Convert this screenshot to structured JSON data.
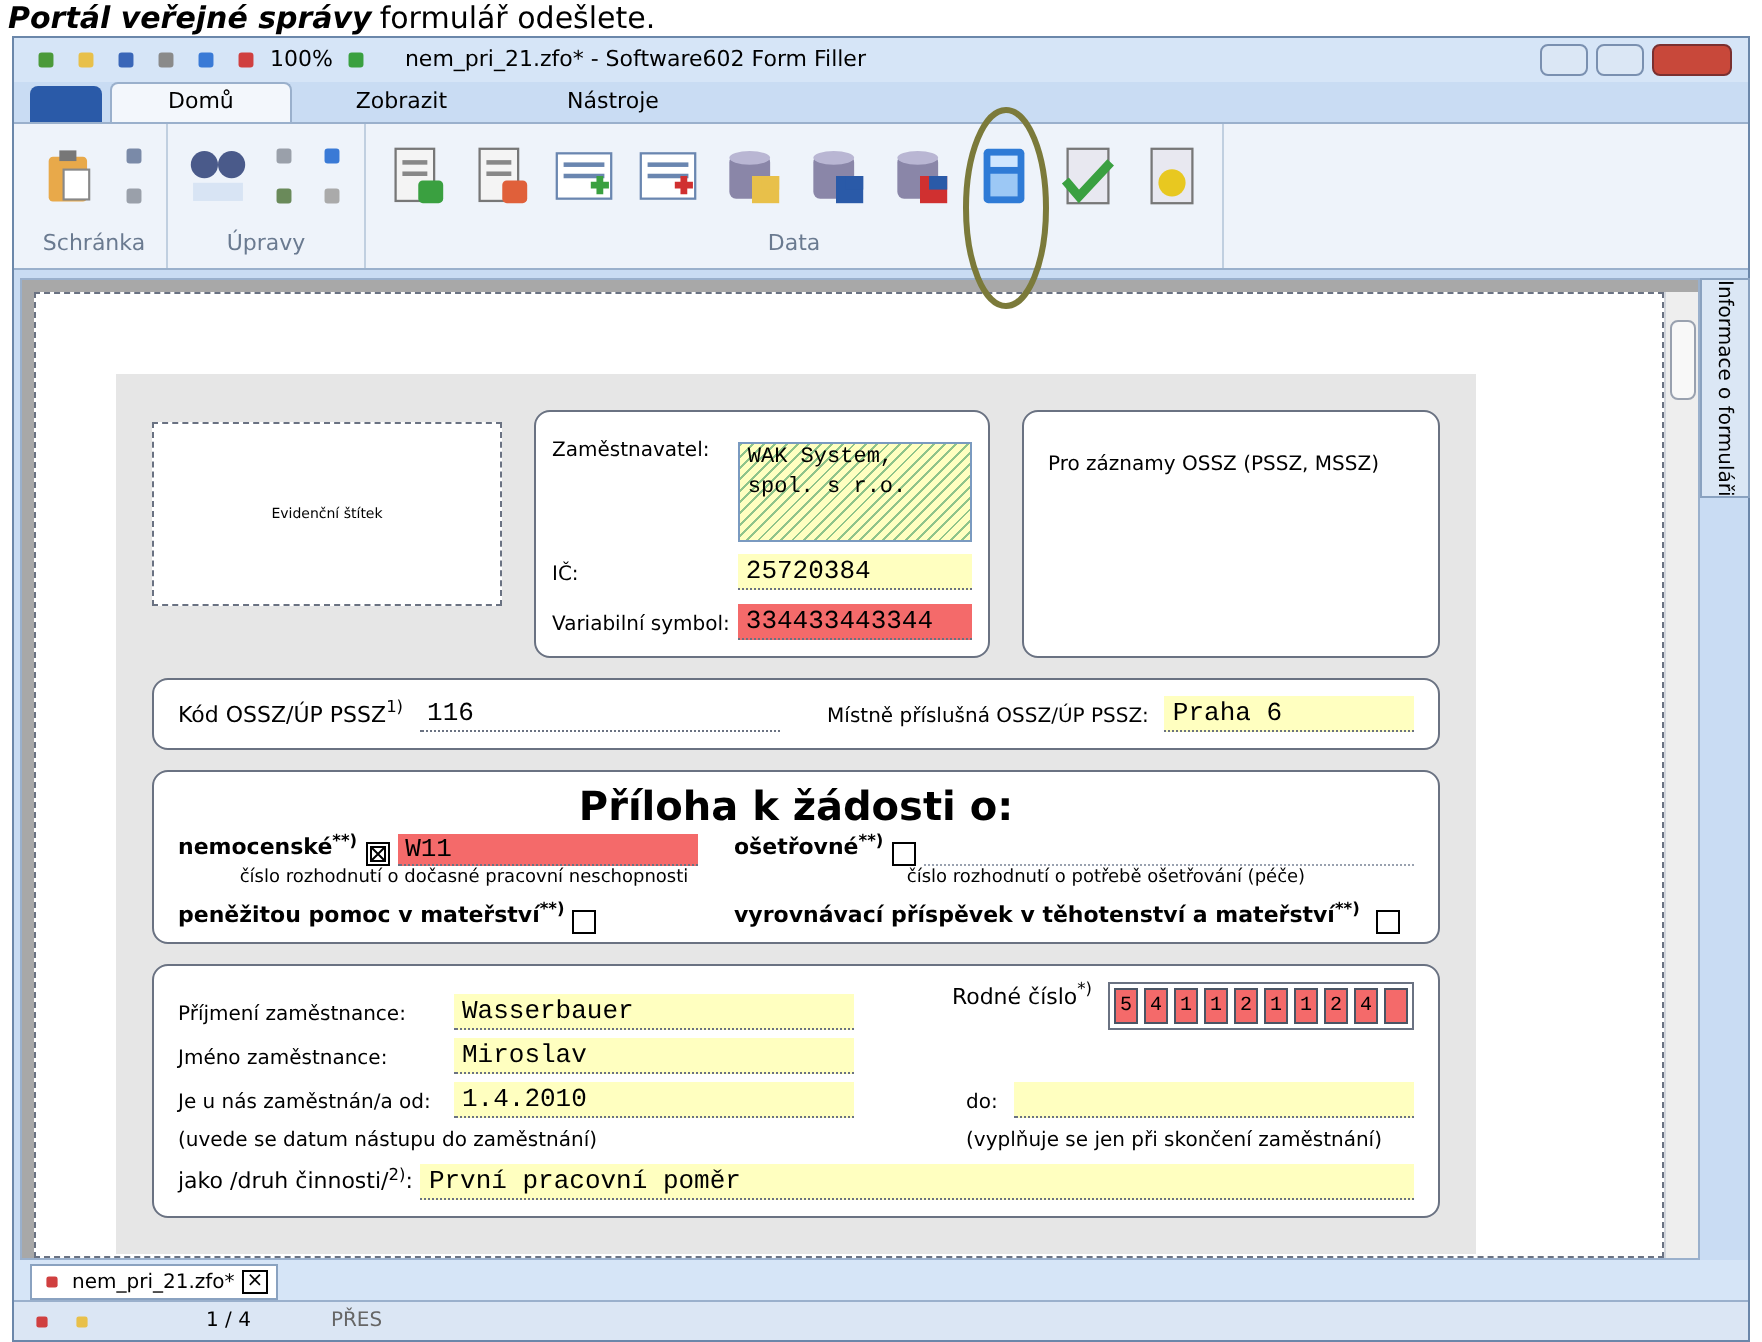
{
  "caption": {
    "emphasis": "Portál veřejné správy",
    "rest": "formulář odešlete."
  },
  "window": {
    "title": "nem_pri_21.zfo* - Software602 Form Filler",
    "zoom": "100%"
  },
  "tabs": [
    {
      "label": "Domů",
      "selected": true
    },
    {
      "label": "Zobrazit",
      "selected": false
    },
    {
      "label": "Nástroje",
      "selected": false
    }
  ],
  "ribbon_groups": [
    {
      "label": "Schránka"
    },
    {
      "label": "Úpravy"
    },
    {
      "label": "Data"
    }
  ],
  "side_panel": {
    "label": "Informace o formuláři"
  },
  "form": {
    "sticker": "Evidenční štítek",
    "employer": {
      "label": "Zaměstnavatel:",
      "value": "WAK System, spol. s r.o.",
      "error": false
    },
    "ico": {
      "label": "IČ:",
      "value": "25720384",
      "error": false
    },
    "variable_symbol": {
      "label": "Variabilní symbol:",
      "value": "334433443344",
      "error": true
    },
    "records": "Pro záznamy OSSZ (PSSZ, MSSZ)",
    "ossz_code": {
      "label": "Kód OSSZ/ÚP PSSZ",
      "note": "1)",
      "value": "116"
    },
    "local_ossz": {
      "label": "Místně příslušná OSSZ/ÚP PSSZ:",
      "value": "Praha 6"
    },
    "heading": "Příloha k žádosti o:",
    "options": [
      {
        "label": "nemocenské",
        "note": "**)",
        "checked": true,
        "number": "W11",
        "error": true,
        "hint": "číslo rozhodnutí o dočasné pracovní neschopnosti"
      },
      {
        "label": "ošetřovné",
        "note": "**)",
        "checked": false,
        "hint": "číslo rozhodnutí o potřebě ošetřování (péče)"
      },
      {
        "label": "peněžitou pomoc v mateřství",
        "note": "**)",
        "checked": false
      },
      {
        "label": "vyrovnávací příspěvek v těhotenství a mateřství",
        "note": "**)",
        "checked": false
      }
    ],
    "surname": {
      "label": "Příjmení zaměstnance:",
      "value": "Wasserbauer"
    },
    "birth_number": {
      "label": "Rodné číslo",
      "note": "*)",
      "digits": [
        "5",
        "4",
        "1",
        "1",
        "2",
        "1",
        "1",
        "2",
        "4"
      ],
      "error": true
    },
    "first_name": {
      "label": "Jméno zaměstnance:",
      "value": "Miroslav"
    },
    "employed_from": {
      "label": "Je u nás zaměstnán/a od:",
      "value": "1.4.2010",
      "hint": "(uvede se datum nástupu do zaměstnání)"
    },
    "employed_to": {
      "label": "do:",
      "hint": "(vyplňuje se jen při skončení zaměstnání)"
    },
    "activity": {
      "label": "jako /druh činnosti/",
      "note": "2)",
      "suffix": ":",
      "value": "První pracovní poměr"
    }
  },
  "document_tab": {
    "label": "nem_pri_21.zfo*",
    "close": "×"
  },
  "status_bar": {
    "page": "1 / 4",
    "mode": "PŘES"
  }
}
